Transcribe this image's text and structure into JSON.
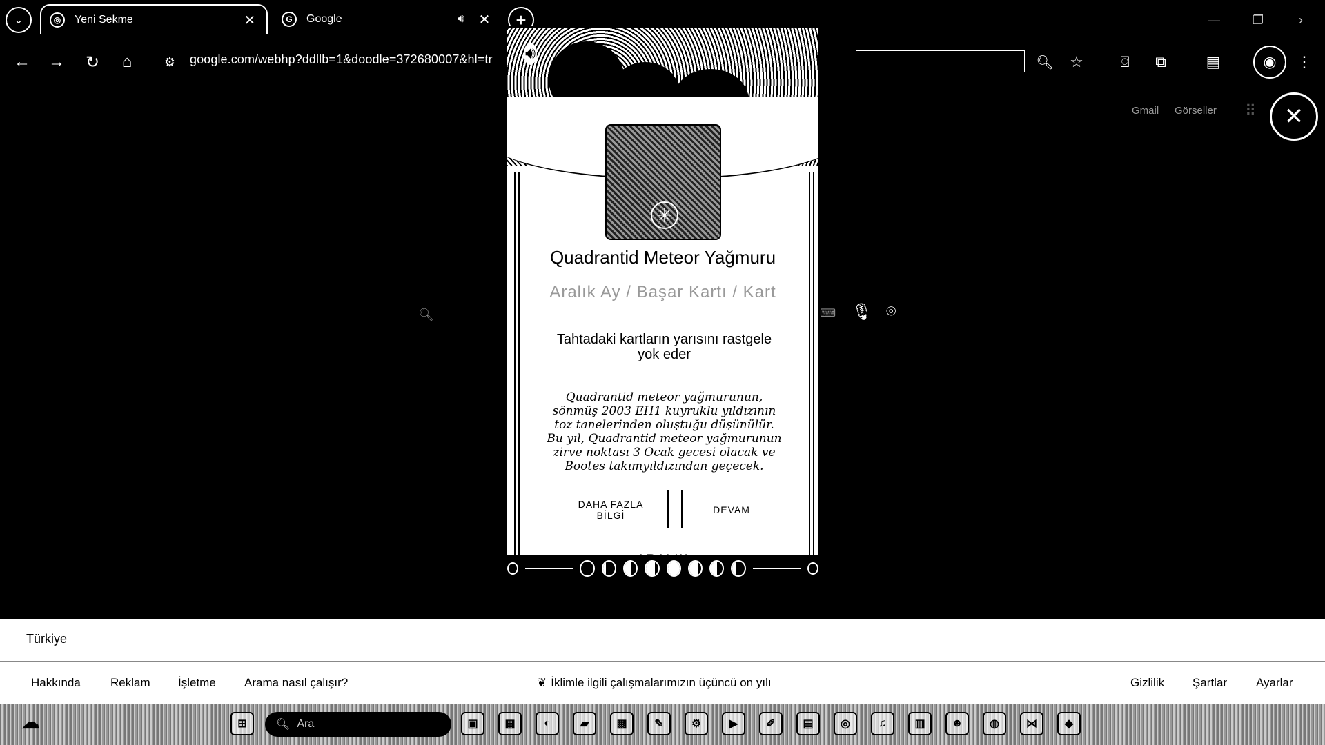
{
  "tabs": [
    {
      "title": "Yeni Sekme",
      "icon": "chrome-icon",
      "active": true
    },
    {
      "title": "Google",
      "icon": "google-icon",
      "active": false,
      "audio": true
    }
  ],
  "toolbar": {
    "url": "google.com/webhp?ddllb=1&doodle=372680007&hl=tr"
  },
  "header_links": {
    "gmail": "Gmail",
    "images": "Görseller"
  },
  "doodle": {
    "title": "Quadrantid Meteor Yağmuru",
    "subtitle": "Aralık Ay / Başar Kartı / Kart",
    "effect": "Tahtadaki kartların yarısını rastgele yok eder",
    "description": "Quadrantid meteor yağmurunun, sönmüş 2003 EH1 kuyruklu yıldızının toz tanelerinden oluştuğu düşünülür. Bu yıl, Quadrantid meteor yağmurunun zirve noktası 3 Ocak gecesi olacak ve Bootes takımyıldızından geçecek.",
    "more_button": "DAHA FAZLA BİLGİ",
    "continue_button": "DEVAM",
    "footer_label": "ARALIK",
    "moon_phases": [
      0,
      0.25,
      0.5,
      0.75,
      1,
      0.75,
      0.5,
      0.25
    ]
  },
  "footer": {
    "country": "Türkiye",
    "left_links": [
      "Hakkında",
      "Reklam",
      "İşletme",
      "Arama nasıl çalışır?"
    ],
    "center_text": "İklimle ilgili çalışmalarımızın üçüncü on yılı",
    "right_links": [
      "Gizlilik",
      "Şartlar",
      "Ayarlar"
    ]
  },
  "taskbar": {
    "search_placeholder": "Ara"
  }
}
